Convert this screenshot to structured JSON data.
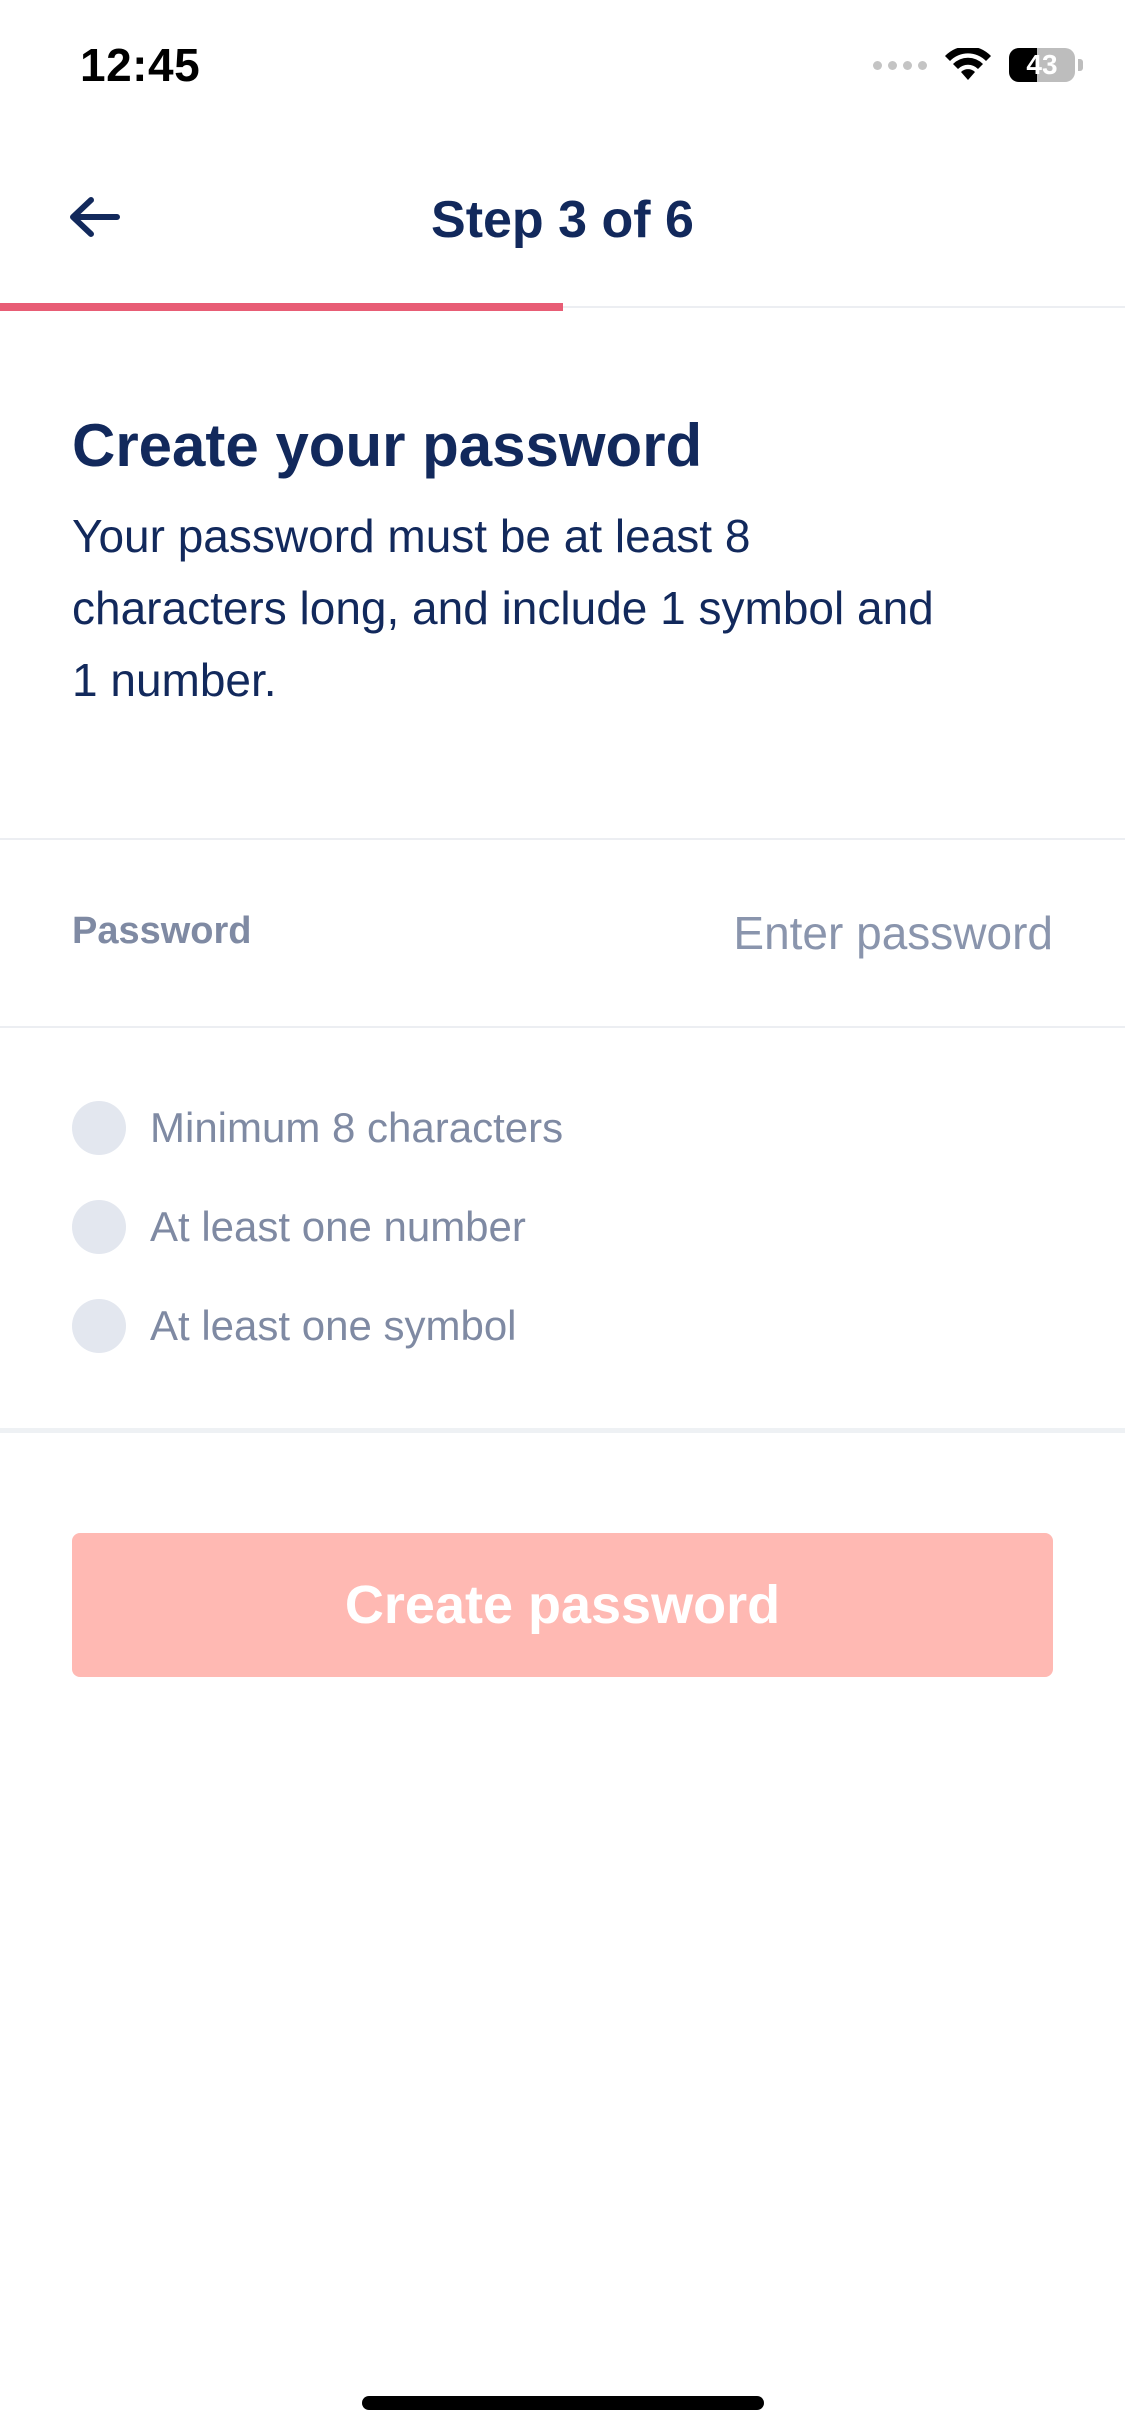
{
  "status_bar": {
    "time": "12:45",
    "battery": "43",
    "battery_level": 0.43,
    "icons": [
      "cellular-signal-icon",
      "wifi-icon",
      "battery-icon"
    ]
  },
  "header": {
    "title": "Step 3 of 6",
    "back_icon": "arrow-left-icon",
    "progress": 0.5,
    "progress_color": "#e85d75"
  },
  "intro": {
    "title": "Create your password",
    "description_lines": [
      "Your password must be at least 8",
      "characters long, and include 1 symbol and",
      "1 number."
    ]
  },
  "password_field": {
    "label": "Password",
    "placeholder": "Enter password",
    "value": ""
  },
  "requirements": [
    {
      "label": "Minimum 8 characters",
      "met": false
    },
    {
      "label": "At least one number",
      "met": false
    },
    {
      "label": "At least one symbol",
      "met": false
    }
  ],
  "submit": {
    "label": "Create password",
    "enabled": false,
    "color": "#ffb9b3"
  },
  "colors": {
    "primary_text": "#12295c",
    "muted_text": "#7f8aa3",
    "accent": "#e85d75"
  }
}
